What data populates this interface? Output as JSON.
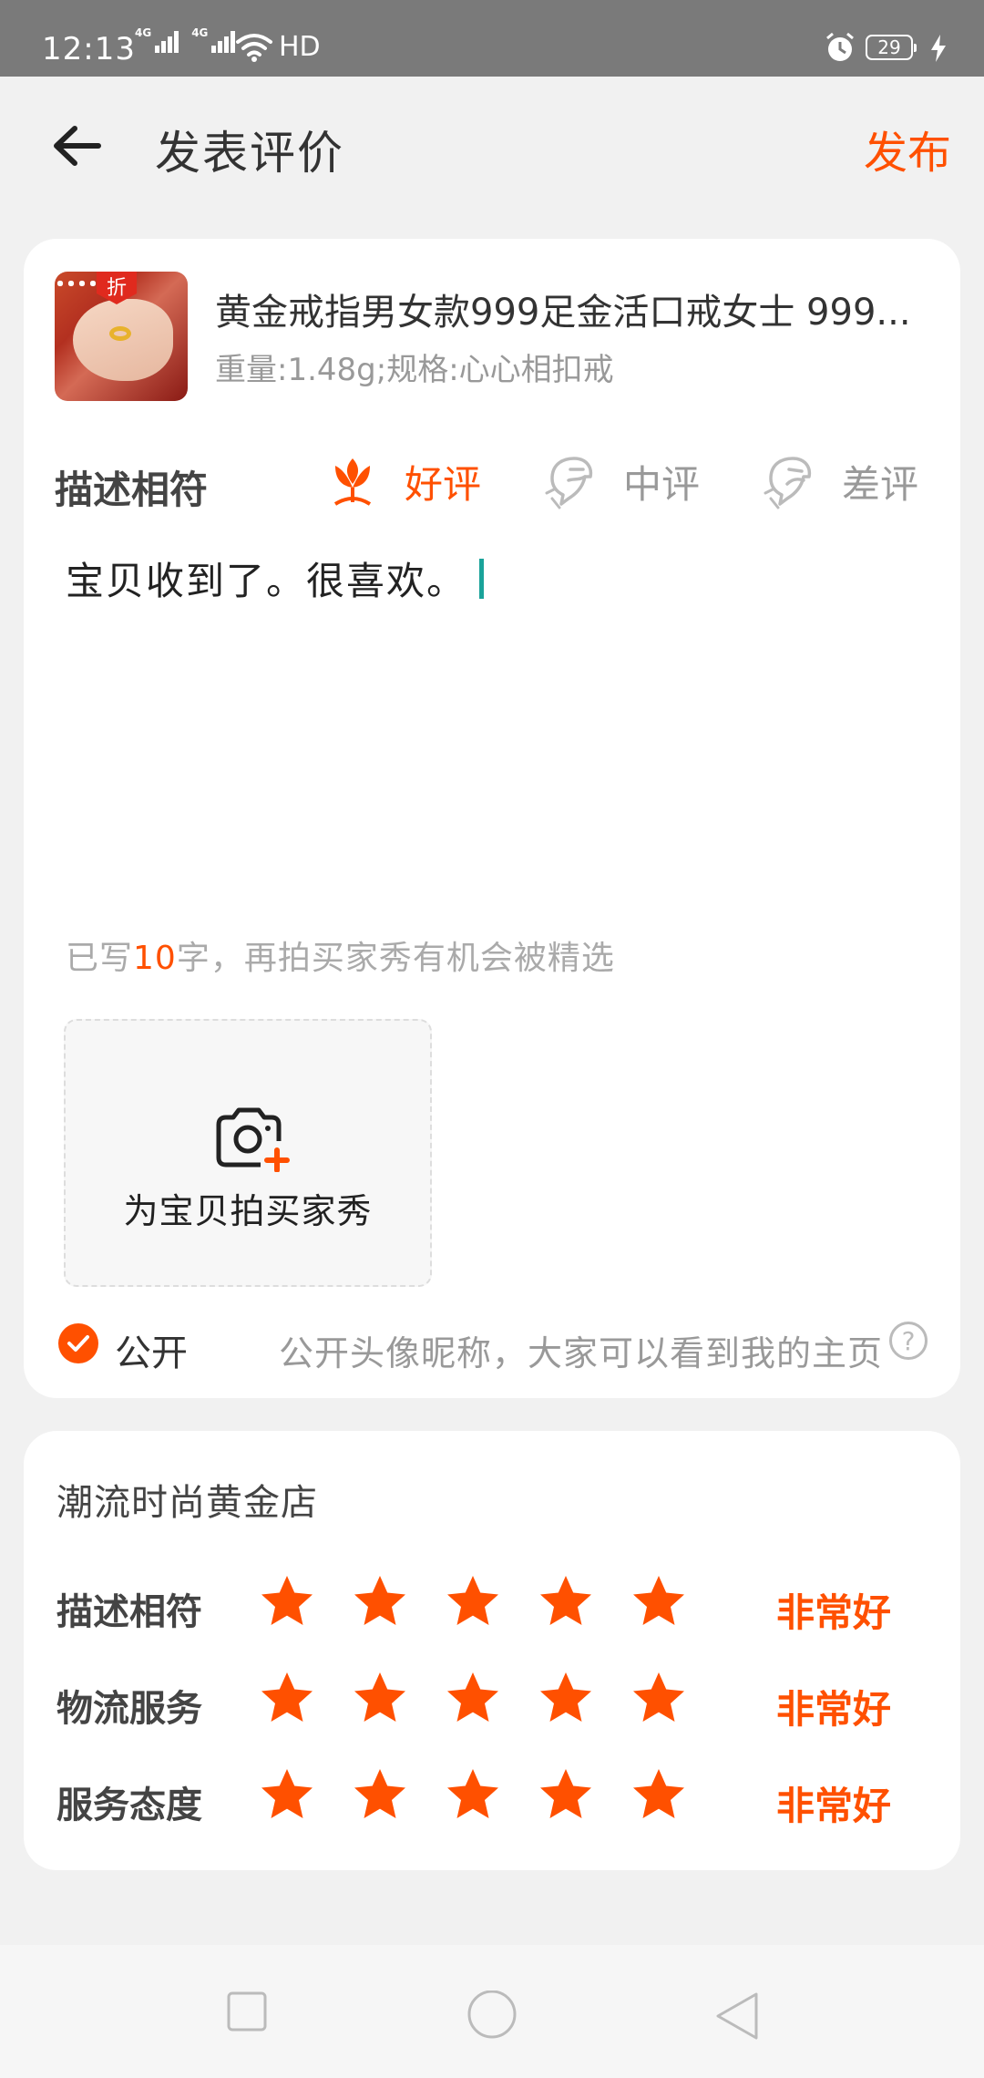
{
  "status_bar": {
    "time": "12:13",
    "network1": "4G",
    "network2": "4G",
    "hd_label": "HD",
    "battery_level": "29"
  },
  "header": {
    "title": "发表评价",
    "publish_label": "发布",
    "back_icon": "arrow-left-icon"
  },
  "product": {
    "title": "黄金戒指男女款999足金活口戒女士 999...",
    "spec": "重量:1.48g;规格:心心相扣戒",
    "image_badge": "折"
  },
  "description_rating": {
    "label": "描述相符",
    "options": [
      {
        "label": "好评",
        "icon": "flower-icon",
        "selected": true
      },
      {
        "label": "中评",
        "icon": "neutral-face-icon",
        "selected": false
      },
      {
        "label": "差评",
        "icon": "sad-face-icon",
        "selected": false
      }
    ]
  },
  "review": {
    "text": "宝贝收到了。很喜欢。",
    "count_prefix": "已写",
    "count_number": "10",
    "count_suffix": "字，再拍买家秀有机会被精选"
  },
  "photo_upload": {
    "label": "为宝贝拍买家秀",
    "icon": "camera-add-icon"
  },
  "public": {
    "label": "公开",
    "checked": true,
    "description": "公开头像昵称，大家可以看到我的主页",
    "help_icon": "question-icon"
  },
  "shop": {
    "name": "潮流时尚黄金店",
    "ratings": [
      {
        "label": "描述相符",
        "stars": 5,
        "max": 5,
        "value_label": "非常好"
      },
      {
        "label": "物流服务",
        "stars": 5,
        "max": 5,
        "value_label": "非常好"
      },
      {
        "label": "服务态度",
        "stars": 5,
        "max": 5,
        "value_label": "非常好"
      }
    ]
  },
  "colors": {
    "accent": "#ff5000",
    "inactive": "#999999",
    "cursor": "#1aa39a"
  }
}
